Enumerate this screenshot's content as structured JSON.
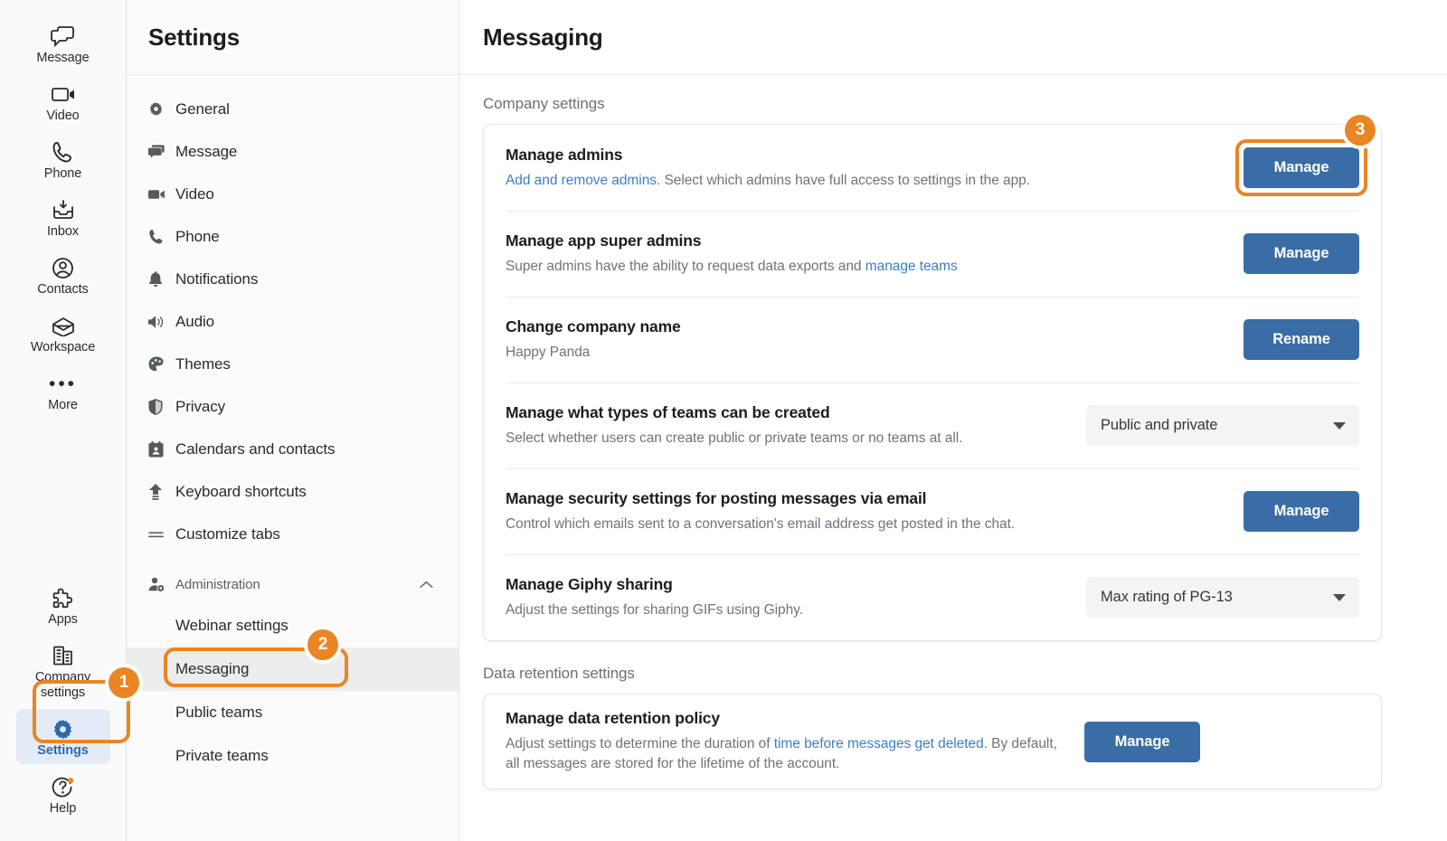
{
  "rail": {
    "items": [
      {
        "label": "Message",
        "icon": "message-icon"
      },
      {
        "label": "Video",
        "icon": "video-icon"
      },
      {
        "label": "Phone",
        "icon": "phone-icon"
      },
      {
        "label": "Inbox",
        "icon": "inbox-icon"
      },
      {
        "label": "Contacts",
        "icon": "contacts-icon"
      },
      {
        "label": "Workspace",
        "icon": "workspace-icon"
      },
      {
        "label": "More",
        "icon": "more-dots-icon"
      }
    ],
    "bottom": [
      {
        "label": "Apps",
        "icon": "apps-puzzle-icon"
      },
      {
        "label": "Company settings",
        "icon": "company-building-icon"
      },
      {
        "label": "Settings",
        "icon": "gear-icon"
      },
      {
        "label": "Help",
        "icon": "help-question-icon"
      }
    ]
  },
  "nav": {
    "title": "Settings",
    "items": [
      {
        "label": "General",
        "icon": "gear-icon"
      },
      {
        "label": "Message",
        "icon": "message-icon"
      },
      {
        "label": "Video",
        "icon": "video-icon"
      },
      {
        "label": "Phone",
        "icon": "phone-icon"
      },
      {
        "label": "Notifications",
        "icon": "bell-icon"
      },
      {
        "label": "Audio",
        "icon": "speaker-icon"
      },
      {
        "label": "Themes",
        "icon": "palette-icon"
      },
      {
        "label": "Privacy",
        "icon": "shield-icon"
      },
      {
        "label": "Calendars and contacts",
        "icon": "calendar-icon"
      },
      {
        "label": "Keyboard shortcuts",
        "icon": "keyboard-icon"
      },
      {
        "label": "Customize tabs",
        "icon": "equals-icon"
      }
    ],
    "administration": {
      "label": "Administration",
      "icon": "admin-user-icon",
      "chevron": "chevron-up-icon",
      "children": [
        {
          "label": "Webinar settings"
        },
        {
          "label": "Messaging"
        },
        {
          "label": "Public teams"
        },
        {
          "label": "Private teams"
        }
      ]
    }
  },
  "main": {
    "title": "Messaging",
    "company_section_label": "Company settings",
    "retention_section_label": "Data retention settings",
    "company_rows": [
      {
        "title": "Manage admins",
        "desc_link": "Add and remove admins",
        "desc_rest": ". Select which admins have full access to settings in the app.",
        "control": "button",
        "button_label": "Manage"
      },
      {
        "title": "Manage app super admins",
        "desc_pre": "Super admins have the ability to request data exports and ",
        "desc_link": "manage teams",
        "control": "button",
        "button_label": "Manage"
      },
      {
        "title": "Change company name",
        "desc_pre": "Happy Panda",
        "control": "button",
        "button_label": "Rename"
      },
      {
        "title": "Manage what types of teams can be created",
        "desc_pre": "Select whether users can create public or private teams or no teams at all.",
        "control": "select",
        "select_value": "Public and private"
      },
      {
        "title": "Manage security settings for posting messages via email",
        "desc_pre": "Control which emails sent to a conversation's email address get posted in the chat.",
        "control": "button",
        "button_label": "Manage"
      },
      {
        "title": "Manage Giphy sharing",
        "desc_pre": "Adjust the settings for sharing GIFs using Giphy.",
        "control": "select",
        "select_value": "Max rating of PG-13"
      }
    ],
    "retention_rows": [
      {
        "title": "Manage data retention policy",
        "desc_pre": "Adjust settings to determine the duration of ",
        "desc_link": "time before messages get deleted",
        "desc_rest": ". By default, all messages are stored for the lifetime of the account.",
        "control": "button",
        "button_label": "Manage"
      }
    ]
  },
  "annotations": {
    "step1": "1",
    "step2": "2",
    "step3": "3"
  },
  "colors": {
    "accent_blue": "#3a6da6",
    "highlight_orange": "#ea8523",
    "link_blue": "#3f7fc1"
  }
}
